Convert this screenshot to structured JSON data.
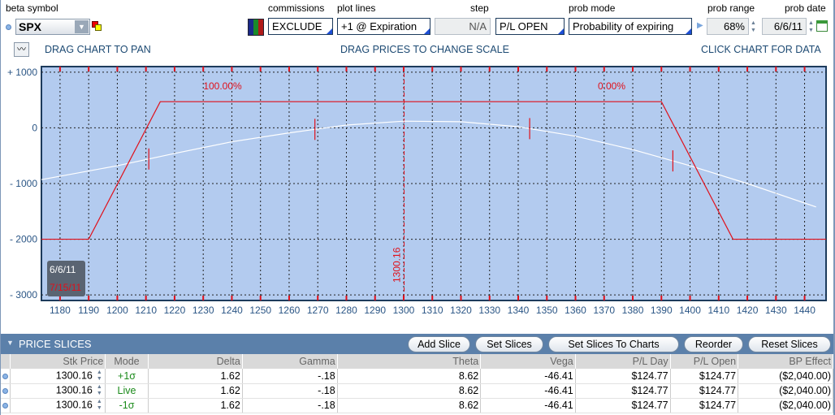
{
  "toolbar": {
    "beta_symbol_label": "beta symbol",
    "beta_symbol_value": "SPX",
    "commissions_label": "commissions",
    "commissions_value": "EXCLUDE",
    "plot_lines_label": "plot lines",
    "plot_lines_value": "+1 @ Expiration",
    "step_label": "step",
    "step_value": "N/A",
    "pl_value": "P/L OPEN",
    "prob_mode_label": "prob mode",
    "prob_mode_value": "Probability of expiring",
    "prob_range_label": "prob range",
    "prob_range_value": "68%",
    "prob_date_label": "prob date",
    "prob_date_value": "6/6/11"
  },
  "hints": {
    "pan": "DRAG CHART TO PAN",
    "scale": "DRAG PRICES TO CHANGE SCALE",
    "data": "CLICK CHART FOR DATA"
  },
  "chart_data": {
    "type": "line",
    "x_ticks": [
      1180,
      1190,
      1200,
      1210,
      1220,
      1230,
      1240,
      1250,
      1260,
      1270,
      1280,
      1290,
      1300,
      1310,
      1320,
      1330,
      1340,
      1350,
      1360,
      1370,
      1380,
      1390,
      1400,
      1410,
      1420,
      1430,
      1440
    ],
    "y_ticks": [
      {
        "v": 1000,
        "label": "+ 1000"
      },
      {
        "v": 0,
        "label": "0"
      },
      {
        "v": -1000,
        "label": "- 1000"
      },
      {
        "v": -2000,
        "label": "- 2000"
      },
      {
        "v": -3000,
        "label": "- 3000"
      }
    ],
    "xlim": [
      1173.5,
      1447.5
    ],
    "ylim": [
      -3100,
      1100
    ],
    "series": [
      {
        "name": "7/15/11",
        "color": "#e0101a",
        "points": [
          [
            1173.5,
            -2000
          ],
          [
            1190,
            -2000
          ],
          [
            1215,
            470
          ],
          [
            1390,
            470
          ],
          [
            1415,
            -2000
          ],
          [
            1447.5,
            -2000
          ]
        ]
      },
      {
        "name": "6/6/11",
        "color": "#ffffff",
        "points": [
          [
            1173.5,
            -930
          ],
          [
            1200,
            -680
          ],
          [
            1220,
            -460
          ],
          [
            1240,
            -250
          ],
          [
            1260,
            -90
          ],
          [
            1280,
            50
          ],
          [
            1300,
            120
          ],
          [
            1320,
            110
          ],
          [
            1340,
            20
          ],
          [
            1360,
            -150
          ],
          [
            1380,
            -390
          ],
          [
            1400,
            -680
          ],
          [
            1420,
            -1000
          ],
          [
            1444,
            -1420
          ]
        ]
      }
    ],
    "breakeven_marks": [
      1211,
      1269,
      1344,
      1394
    ],
    "current_price": 1300.16,
    "current_price_label": "1300.16",
    "prob_left": "100.00%",
    "prob_right": "0.00%",
    "legend": {
      "date1": "6/6/11",
      "date2": "7/15/11"
    }
  },
  "slices": {
    "title": "PRICE SLICES",
    "buttons": [
      "Add Slice",
      "Set Slices",
      "Set Slices To Charts",
      "Reorder",
      "Reset Slices"
    ],
    "columns": [
      "Stk Price",
      "Mode",
      "Delta",
      "Gamma",
      "Theta",
      "Vega",
      "P/L Day",
      "P/L Open",
      "BP Effect"
    ],
    "rows": [
      [
        "1300.16",
        "+1σ",
        "1.62",
        "-.18",
        "8.62",
        "-46.41",
        "$124.77",
        "$124.77",
        "($2,040.00)"
      ],
      [
        "1300.16",
        "Live",
        "1.62",
        "-.18",
        "8.62",
        "-46.41",
        "$124.77",
        "$124.77",
        "($2,040.00)"
      ],
      [
        "1300.16",
        "-1σ",
        "1.62",
        "-.18",
        "8.62",
        "-46.41",
        "$124.77",
        "$124.77",
        "($2,040.00)"
      ]
    ]
  }
}
